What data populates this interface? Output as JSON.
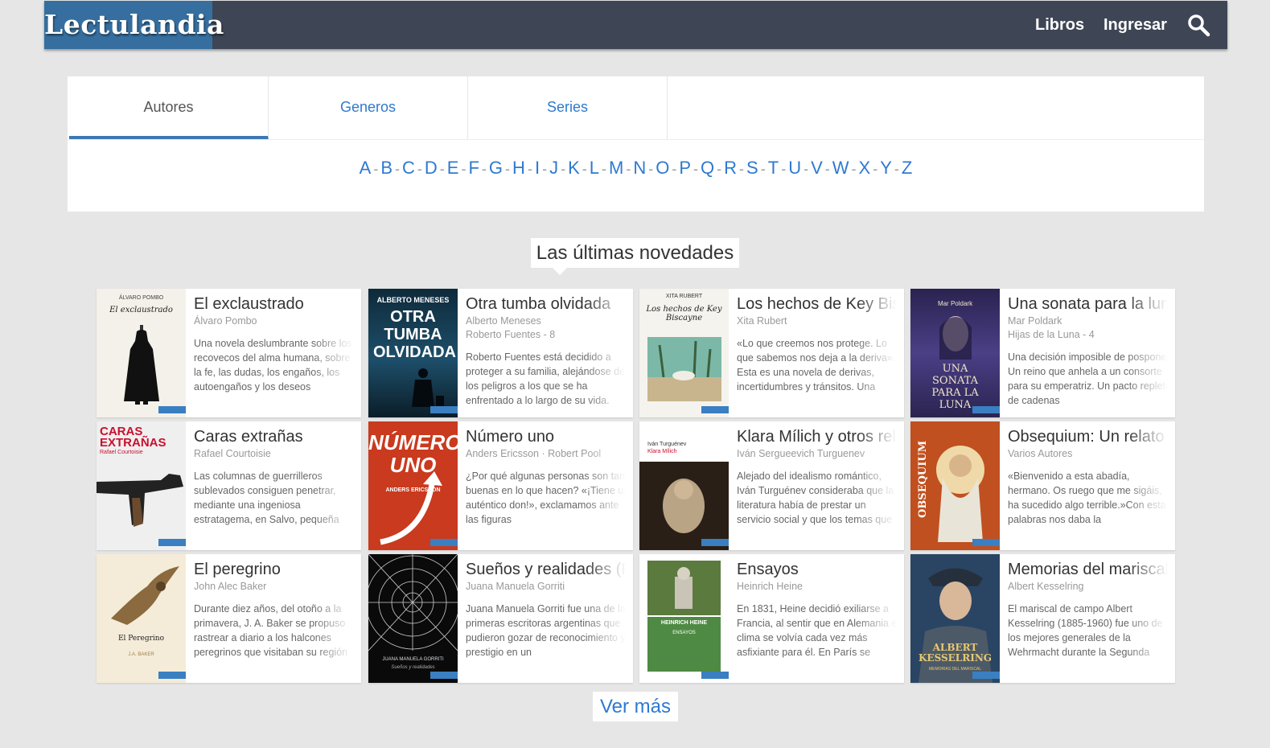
{
  "header": {
    "logo": "Lectulandia",
    "nav": [
      "Libros",
      "Ingresar"
    ]
  },
  "tabs": [
    "Autores",
    "Generos",
    "Series"
  ],
  "alphabet": [
    "A",
    "B",
    "C",
    "D",
    "E",
    "F",
    "G",
    "H",
    "I",
    "J",
    "K",
    "L",
    "M",
    "N",
    "O",
    "P",
    "Q",
    "R",
    "S",
    "T",
    "U",
    "V",
    "W",
    "X",
    "Y",
    "Z"
  ],
  "section_title": "Las últimas novedades",
  "books": [
    {
      "title": "El exclaustrado",
      "author": "Álvaro Pombo",
      "series": "",
      "desc": "Una novela deslumbrante sobre los recovecos del alma humana, sobre la fe, las dudas, los engaños, los autoengaños y los deseos",
      "cover_title": "El exclaustrado",
      "cover_author": "ÁLVARO POMBO"
    },
    {
      "title": "Otra tumba olvidada",
      "author": "Alberto Meneses",
      "series": "Roberto Fuentes - 8",
      "desc": "Roberto Fuentes está decidido a proteger a su familia, alejándose de los peligros a los que se ha enfrentado a lo largo de su vida.",
      "cover_title": "OTRA TUMBA OLVIDADA",
      "cover_author": "ALBERTO MENESES"
    },
    {
      "title": "Los hechos de Key Biscayne",
      "author": "Xita Rubert",
      "series": "",
      "desc": "«Lo que creemos nos protege. Lo que sabemos nos deja a la deriva». Esta es una novela de derivas, incertidumbres y tránsitos. Una",
      "cover_title": "Los hechos de Key Biscayne",
      "cover_author": "XITA RUBERT"
    },
    {
      "title": "Una sonata para la luna",
      "author": "Mar Poldark",
      "series": "Hijas de la Luna - 4",
      "desc": "Una decisión imposible de posponer. Un reino que anhela a un consorte para su emperatriz. Un pacto repleto de cadenas",
      "cover_title": "UNA SONATA PARA LA LUNA",
      "cover_author": "Mar Poldark"
    },
    {
      "title": "Caras extrañas",
      "author": "Rafael Courtoisie",
      "series": "",
      "desc": "Las columnas de guerrilleros sublevados consiguen penetrar, mediante una ingeniosa estratagema, en Salvo, pequeña",
      "cover_title": "CARAS EXTRAÑAS",
      "cover_author": "Rafael Courtoisie"
    },
    {
      "title": "Número uno",
      "author": "Anders Ericsson · Robert Pool",
      "series": "",
      "desc": "¿Por qué algunas personas son tan buenas en lo que hacen? «¡Tiene un auténtico don!», exclamamos ante las figuras",
      "cover_title": "NÚMERO UNO",
      "cover_author": "ANDERS ERICSSON"
    },
    {
      "title": "Klara Mílich y otros relatos",
      "author": "Iván Sergueevich Turguenev",
      "series": "",
      "desc": "Alejado del idealismo romántico, Iván Turguénev consideraba que la literatura había de prestar un servicio social y que los temas que",
      "cover_title": "Klara Mílich",
      "cover_author": "Iván Turguénev"
    },
    {
      "title": "Obsequium: Un relato",
      "author": "Varios Autores",
      "series": "",
      "desc": "«Bienvenido a esta abadía, hermano. Os ruego que me sigáis, ha sucedido algo terrible.»Con estas palabras nos daba la",
      "cover_title": "OBSEQUIUM",
      "cover_author": ""
    },
    {
      "title": "El peregrino",
      "author": "John Alec Baker",
      "series": "",
      "desc": "Durante diez años, del otoño a la primavera, J. A. Baker se propuso rastrear a diario a los halcones peregrinos que visitaban su región",
      "cover_title": "El Peregrino",
      "cover_author": "J.A. BAKER"
    },
    {
      "title": "Sueños y realidades (Fragmentos)",
      "author": "Juana Manuela Gorriti",
      "series": "",
      "desc": "Juana Manuela Gorriti fue una de las primeras escritoras argentinas que pudieron gozar de reconocimiento y prestigio en un",
      "cover_title": "JUANA MANUELA GORRITI",
      "cover_author": "Sueños y realidades"
    },
    {
      "title": "Ensayos",
      "author": "Heinrich Heine",
      "series": "",
      "desc": "En 1831, Heine decidió exiliarse a Francia, al sentir que en Alemania el clima se volvía cada vez más asfixiante para él. En París se",
      "cover_title": "ENSAYOS",
      "cover_author": "HEINRICH HEINE"
    },
    {
      "title": "Memorias del mariscal",
      "author": "Albert Kesselring",
      "series": "",
      "desc": "El mariscal de campo Albert Kesselring (1885-1960) fue uno de los mejores generales de la Wehrmacht durante la Segunda",
      "cover_title": "ALBERT KESSELRING",
      "cover_author": "MEMORIAS DEL MARISCAL"
    }
  ],
  "more_button": "Ver más",
  "colors": {
    "header": "#3e4656",
    "logo_bg": "#366f9f",
    "link": "#2e7ad0",
    "background": "#e6e6e6"
  }
}
